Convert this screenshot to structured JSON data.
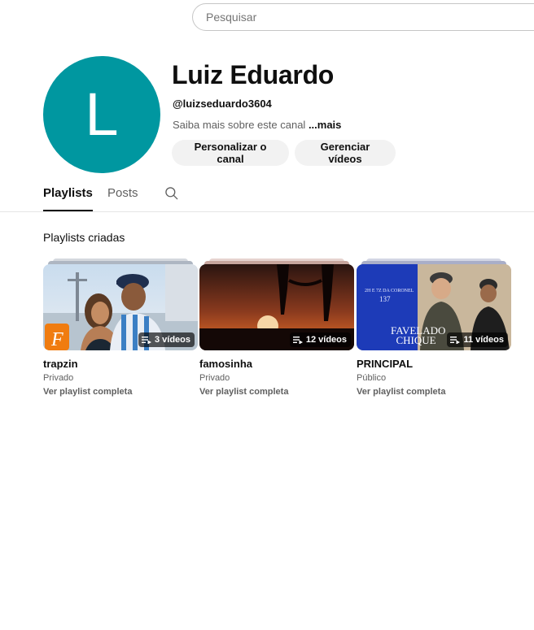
{
  "header": {
    "search_placeholder": "Pesquisar"
  },
  "channel": {
    "avatar_letter": "L",
    "avatar_color": "#0097a0",
    "name": "Luiz Eduardo",
    "handle": "@luizseduardo3604",
    "about": "Saiba mais sobre este canal",
    "about_more": "...mais",
    "buttons": {
      "customize": "Personalizar o canal",
      "manage": "Gerenciar vídeos"
    }
  },
  "tabs": [
    {
      "label": "Playlists",
      "active": true
    },
    {
      "label": "Posts",
      "active": false
    }
  ],
  "section": {
    "title": "Playlists criadas"
  },
  "playlists": [
    {
      "title": "trapzin",
      "privacy": "Privado",
      "count": "3 vídeos",
      "link": "Ver playlist completa",
      "thumb_icon": "photo-couple-thumbnail"
    },
    {
      "title": "famosinha",
      "privacy": "Privado",
      "count": "12 vídeos",
      "link": "Ver playlist completa",
      "thumb_icon": "sunset-silhouette-thumbnail"
    },
    {
      "title": "PRINCIPAL",
      "privacy": "Público",
      "count": "11 vídeos",
      "link": "Ver playlist completa",
      "thumb_icon": "album-cover-thumbnail",
      "thumb_text": {
        "top": "2H E 7Z DA CORONEL",
        "num": "137",
        "logo": "FAVELADO CHIQUE"
      }
    }
  ]
}
